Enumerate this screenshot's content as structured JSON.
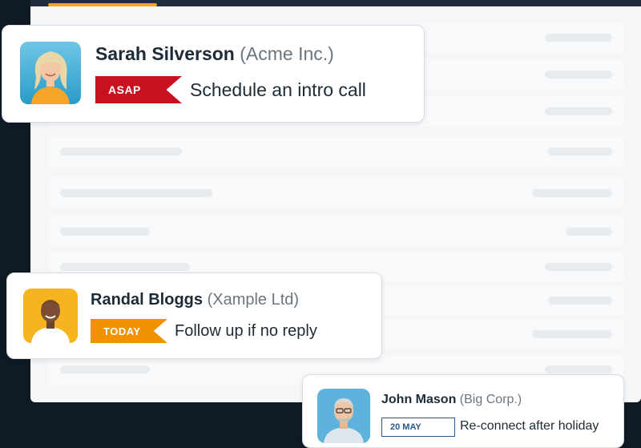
{
  "colors": {
    "asap": "#c8101e",
    "today": "#f39200",
    "date_outline": "#2a5b8a"
  },
  "cards": [
    {
      "name": "Sarah Silverson",
      "company": "(Acme Inc.)",
      "badge": "ASAP",
      "task": "Schedule an intro call",
      "avatar_icon": "woman-avatar-icon"
    },
    {
      "name": "Randal Bloggs",
      "company": "(Xample Ltd)",
      "badge": "TODAY",
      "task": "Follow up if no reply",
      "avatar_icon": "man-avatar-icon"
    },
    {
      "name": "John Mason",
      "company": "(Big Corp.)",
      "badge": "20 MAY",
      "task": "Re-connect after holiday",
      "avatar_icon": "older-man-avatar-icon"
    }
  ]
}
